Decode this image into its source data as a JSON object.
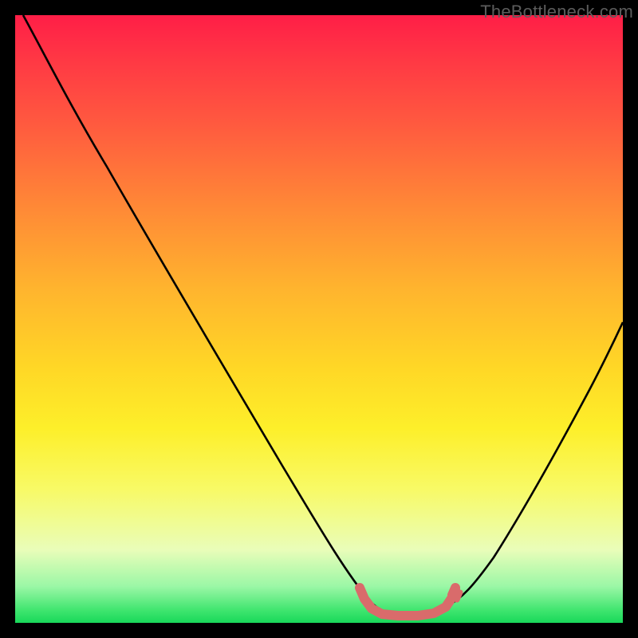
{
  "watermark": "TheBottleneck.com",
  "colors": {
    "frame": "#000000",
    "curve": "#000000",
    "trough_marker": "#d96b6b",
    "gradient_top": "#ff1e47",
    "gradient_bottom": "#19d85a"
  },
  "chart_data": {
    "type": "line",
    "title": "",
    "xlabel": "",
    "ylabel": "",
    "xlim": [
      0,
      100
    ],
    "ylim": [
      0,
      100
    ],
    "grid": false,
    "series": [
      {
        "name": "bottleneck-curve",
        "x": [
          0,
          5,
          10,
          15,
          20,
          25,
          30,
          35,
          40,
          45,
          50,
          55,
          58,
          60,
          63,
          66,
          69,
          72,
          76,
          80,
          85,
          90,
          95,
          100
        ],
        "values": [
          100,
          96,
          90,
          82,
          74,
          65,
          56,
          47,
          38,
          29,
          20,
          11,
          6,
          3,
          1,
          0,
          0,
          1,
          4,
          10,
          20,
          33,
          47,
          60
        ]
      }
    ],
    "annotations": [
      {
        "name": "trough-marker",
        "x_range": [
          56,
          73
        ],
        "y": 1.5
      }
    ]
  }
}
